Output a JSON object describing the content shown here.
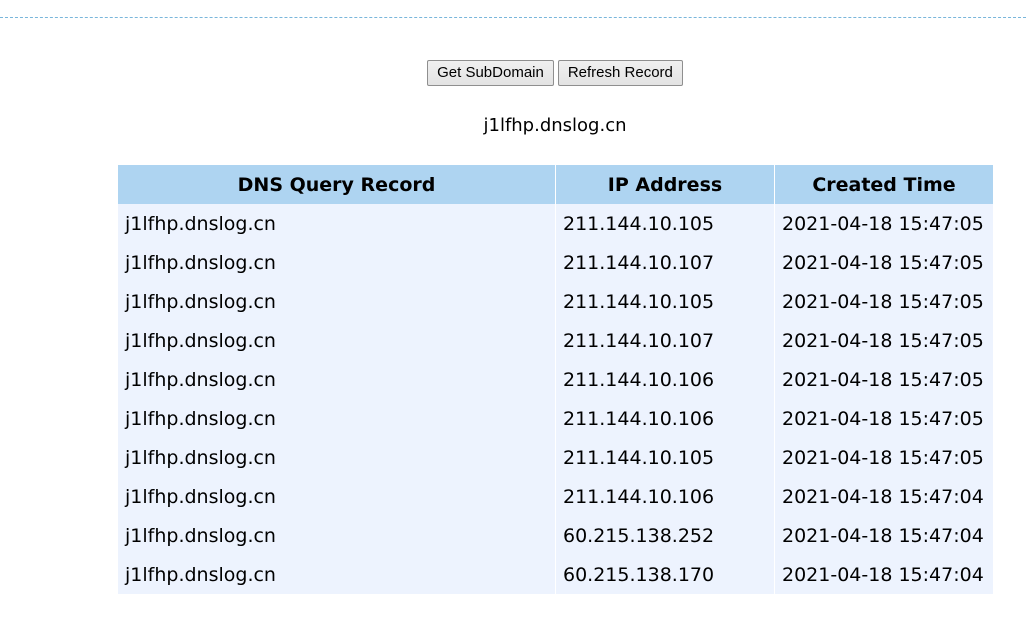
{
  "toolbar": {
    "get_subdomain_label": "Get SubDomain",
    "refresh_record_label": "Refresh Record"
  },
  "subdomain": "j1lfhp.dnslog.cn",
  "table": {
    "headers": [
      "DNS Query Record",
      "IP Address",
      "Created Time"
    ],
    "rows": [
      [
        "j1lfhp.dnslog.cn",
        "211.144.10.105",
        "2021-04-18 15:47:05"
      ],
      [
        "j1lfhp.dnslog.cn",
        "211.144.10.107",
        "2021-04-18 15:47:05"
      ],
      [
        "j1lfhp.dnslog.cn",
        "211.144.10.105",
        "2021-04-18 15:47:05"
      ],
      [
        "j1lfhp.dnslog.cn",
        "211.144.10.107",
        "2021-04-18 15:47:05"
      ],
      [
        "j1lfhp.dnslog.cn",
        "211.144.10.106",
        "2021-04-18 15:47:05"
      ],
      [
        "j1lfhp.dnslog.cn",
        "211.144.10.106",
        "2021-04-18 15:47:05"
      ],
      [
        "j1lfhp.dnslog.cn",
        "211.144.10.105",
        "2021-04-18 15:47:05"
      ],
      [
        "j1lfhp.dnslog.cn",
        "211.144.10.106",
        "2021-04-18 15:47:04"
      ],
      [
        "j1lfhp.dnslog.cn",
        "60.215.138.252",
        "2021-04-18 15:47:04"
      ],
      [
        "j1lfhp.dnslog.cn",
        "60.215.138.170",
        "2021-04-18 15:47:04"
      ]
    ]
  },
  "colors": {
    "header_bg": "#aed4f1",
    "row_bg": "#edf3fe",
    "top_border": "#79b6db"
  }
}
